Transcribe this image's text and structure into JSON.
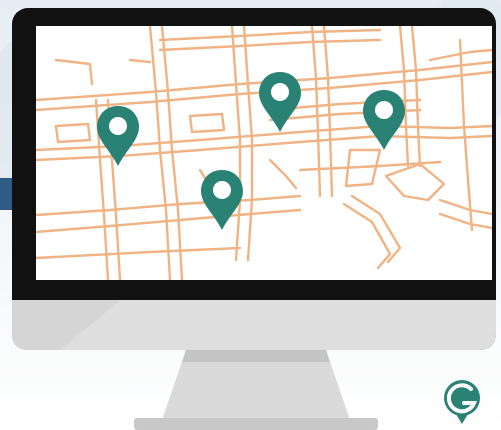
{
  "illustration": {
    "subject": "computer-monitor-with-map",
    "pin_count": 4
  },
  "colors": {
    "background_top": "#e8eef4",
    "background_bottom": "#ffffff",
    "side_band": "#2f5b86",
    "monitor_frame": "#111111",
    "monitor_chin": "#dcdcdc",
    "monitor_stand": "#cfcfcf",
    "screen": "#ffffff",
    "streets": "#f0b384",
    "pin": "#2a8275",
    "logo": "#2a8275"
  },
  "logo": {
    "letter": "G"
  },
  "icons": [
    "map-pin-icon",
    "brand-logo-icon"
  ]
}
